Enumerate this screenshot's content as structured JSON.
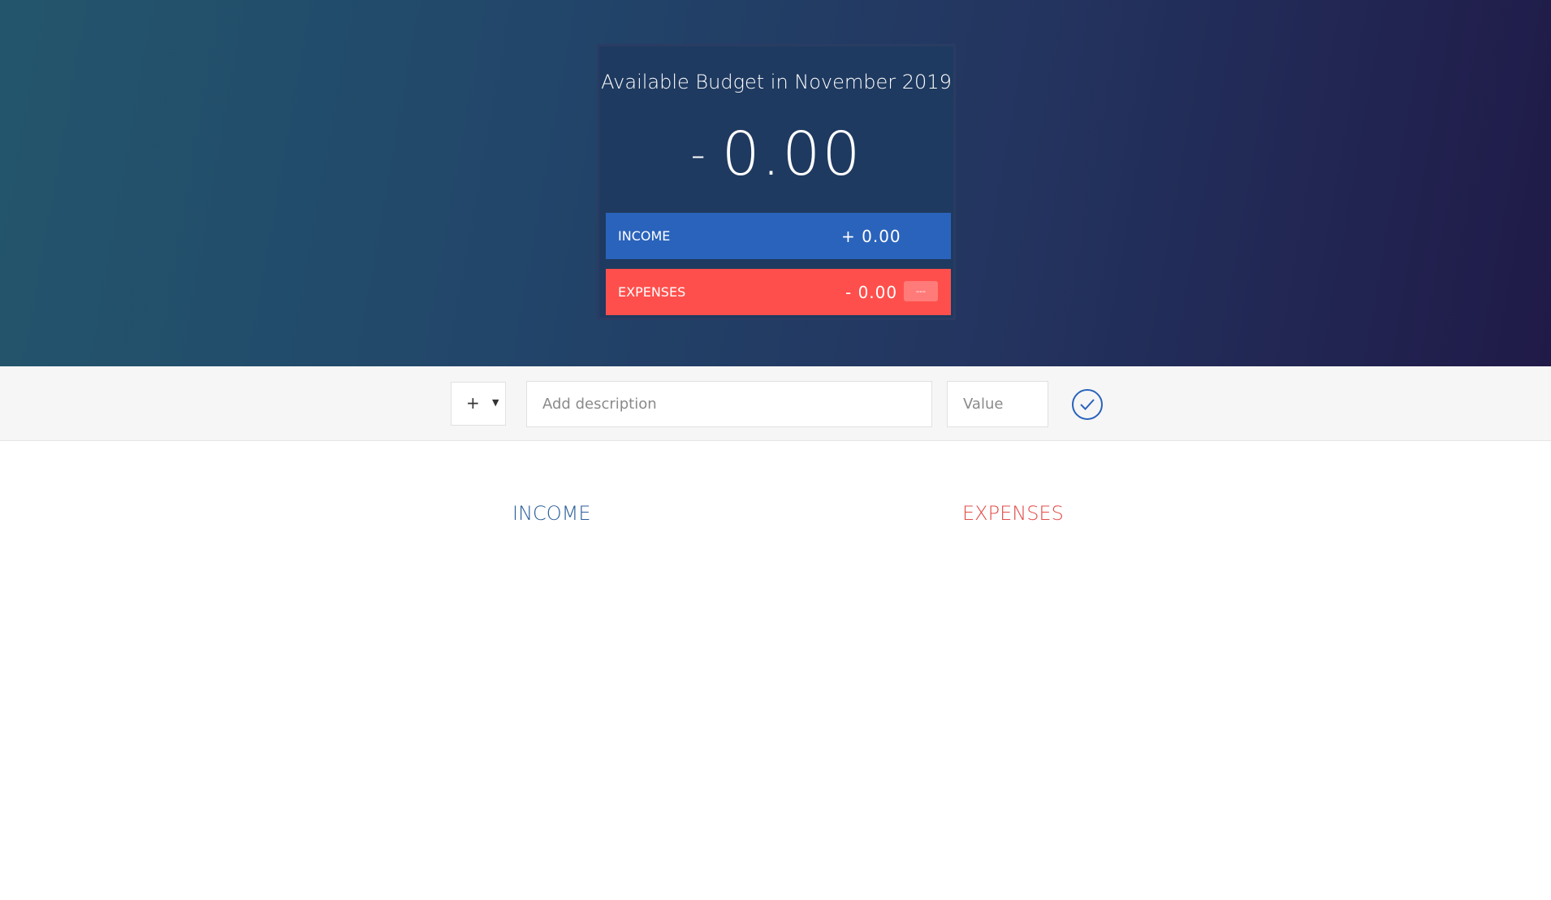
{
  "header": {
    "title": "Available Budget in November 2019",
    "budget_sign": "-",
    "budget_value": "0.00",
    "income": {
      "label": "INCOME",
      "value": "+ 0.00"
    },
    "expenses": {
      "label": "EXPENSES",
      "value": "- 0.00",
      "percentage": "---"
    }
  },
  "add_form": {
    "type_value": "+",
    "type_caret": "▼",
    "description_placeholder": "Add description",
    "value_placeholder": "Value",
    "submit_icon": "checkmark-circle-icon"
  },
  "lists": {
    "income_title": "INCOME",
    "expenses_title": "EXPENSES"
  },
  "colors": {
    "income": "#2a63bb",
    "expenses": "#ff4f4c",
    "income_heading": "#2a5d9a",
    "expenses_heading": "#e24d48"
  }
}
